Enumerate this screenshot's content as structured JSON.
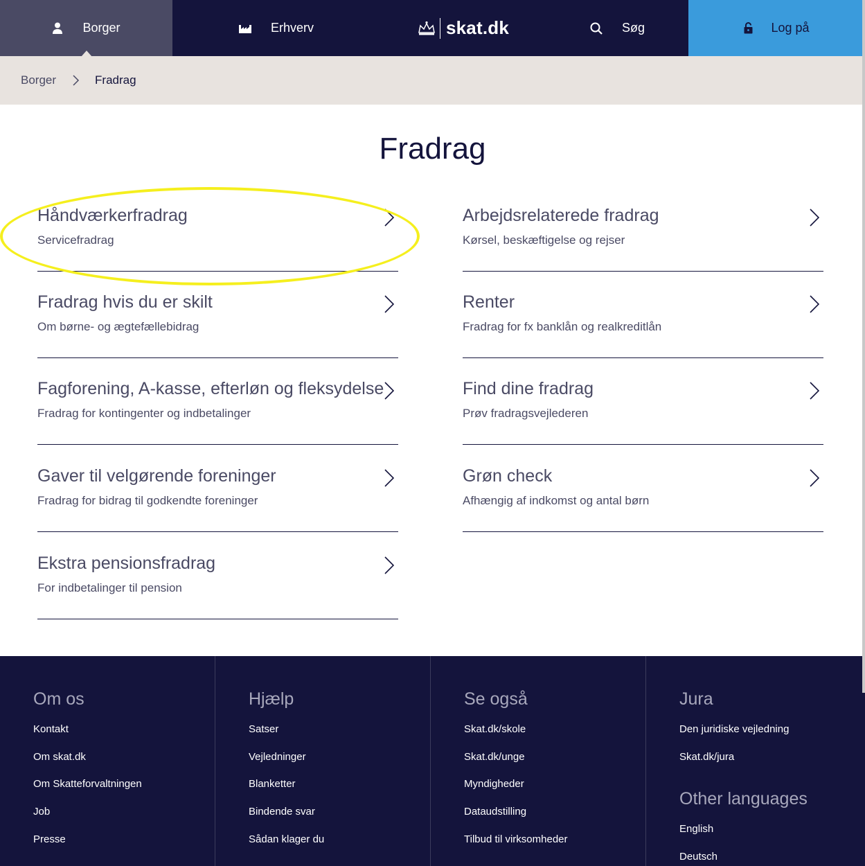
{
  "nav": {
    "borger": "Borger",
    "erhverv": "Erhverv",
    "logo": "skat.dk",
    "search": "Søg",
    "login": "Log på"
  },
  "breadcrumb": {
    "parent": "Borger",
    "current": "Fradrag"
  },
  "page_title": "Fradrag",
  "cards": [
    {
      "title": "Håndværkerfradrag",
      "subtitle": "Servicefradrag"
    },
    {
      "title": "Arbejdsrelaterede fradrag",
      "subtitle": "Kørsel, beskæftigelse og rejser"
    },
    {
      "title": "Fradrag hvis du er skilt",
      "subtitle": "Om børne- og ægtefællebidrag"
    },
    {
      "title": "Renter",
      "subtitle": "Fradrag for fx banklån og realkreditlån"
    },
    {
      "title": "Fagforening, A-kasse, efterløn og fleksydelse",
      "subtitle": "Fradrag for kontingenter og indbetalinger"
    },
    {
      "title": "Find dine fradrag",
      "subtitle": "Prøv fradragsvejlederen"
    },
    {
      "title": "Gaver til velgørende foreninger",
      "subtitle": "Fradrag for bidrag til godkendte foreninger"
    },
    {
      "title": "Grøn check",
      "subtitle": "Afhængig af indkomst og antal børn"
    },
    {
      "title": "Ekstra pensionsfradrag",
      "subtitle": "For indbetalinger til pension"
    }
  ],
  "footer": {
    "om_os": {
      "heading": "Om os",
      "links": [
        "Kontakt",
        "Om skat.dk",
        "Om Skatteforvaltningen",
        "Job",
        "Presse"
      ]
    },
    "hjaelp": {
      "heading": "Hjælp",
      "links": [
        "Satser",
        "Vejledninger",
        "Blanketter",
        "Bindende svar",
        "Sådan klager du"
      ]
    },
    "se_ogsaa": {
      "heading": "Se også",
      "links": [
        "Skat.dk/skole",
        "Skat.dk/unge",
        "Myndigheder",
        "Dataudstilling",
        "Tilbud til virksomheder"
      ]
    },
    "jura": {
      "heading": "Jura",
      "links": [
        "Den juridiske vejledning",
        "Skat.dk/jura"
      ]
    },
    "other_languages": {
      "heading": "Other languages",
      "links": [
        "English",
        "Deutsch"
      ]
    }
  },
  "colors": {
    "navy": "#14143c",
    "nav_active": "#4a4a64",
    "login_blue": "#3a9bdc",
    "breadcrumb_bg": "#e8e3df",
    "highlight": "#f5ef1e"
  }
}
